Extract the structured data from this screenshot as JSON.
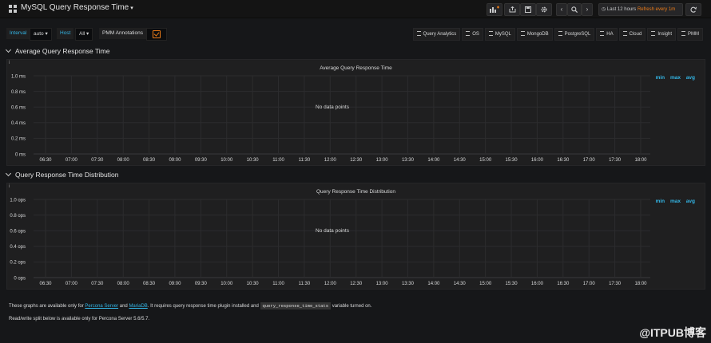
{
  "navbar": {
    "dashboard_title": "MySQL Query Response Time",
    "time_range": "Last 12 hours",
    "refresh": "Refresh every 1m"
  },
  "variables": {
    "interval_label": "Interval",
    "interval_value": "auto",
    "host_label": "Host",
    "host_value": "All",
    "annotations_label": "PMM Annotations"
  },
  "links": [
    "Query Analytics",
    "OS",
    "MySQL",
    "MongoDB",
    "PostgreSQL",
    "HA",
    "Cloud",
    "Insight",
    "PMM"
  ],
  "rows": [
    {
      "title": "Average Query Response Time"
    },
    {
      "title": "Query Response Time Distribution"
    }
  ],
  "panels": [
    {
      "title": "Average Query Response Time",
      "no_data": "No data points",
      "legend": [
        "min",
        "max",
        "avg"
      ],
      "y_ticks": [
        "1.0 ms",
        "0.8 ms",
        "0.6 ms",
        "0.4 ms",
        "0.2 ms",
        "0 ms"
      ],
      "x_ticks": [
        "06:30",
        "07:00",
        "07:30",
        "08:00",
        "08:30",
        "09:00",
        "09:30",
        "10:00",
        "10:30",
        "11:00",
        "11:30",
        "12:00",
        "12:30",
        "13:00",
        "13:30",
        "14:00",
        "14:30",
        "15:00",
        "15:30",
        "16:00",
        "16:30",
        "17:00",
        "17:30",
        "18:00"
      ]
    },
    {
      "title": "Query Response Time Distribution",
      "no_data": "No data points",
      "legend": [
        "min",
        "max",
        "avg"
      ],
      "y_ticks": [
        "1.0 ops",
        "0.8 ops",
        "0.6 ops",
        "0.4 ops",
        "0.2 ops",
        "0 ops"
      ],
      "x_ticks": [
        "06:30",
        "07:00",
        "07:30",
        "08:00",
        "08:30",
        "09:00",
        "09:30",
        "10:00",
        "10:30",
        "11:00",
        "11:30",
        "12:00",
        "12:30",
        "13:00",
        "13:30",
        "14:00",
        "14:30",
        "15:00",
        "15:30",
        "16:00",
        "16:30",
        "17:00",
        "17:30",
        "18:00"
      ]
    }
  ],
  "footer": {
    "line1_a": "These graphs are available only for ",
    "link_percona": "Percona Server",
    "and": " and ",
    "link_mariadb": "MariaDB",
    "line1_b": ". It requires query response time plugin installed and ",
    "code": "query_response_time_stats",
    "line1_c": " variable turned on.",
    "line2": "Read/write split below is available only for Percona Server 5.6/5.7."
  },
  "watermark": "@ITPUB博客"
}
